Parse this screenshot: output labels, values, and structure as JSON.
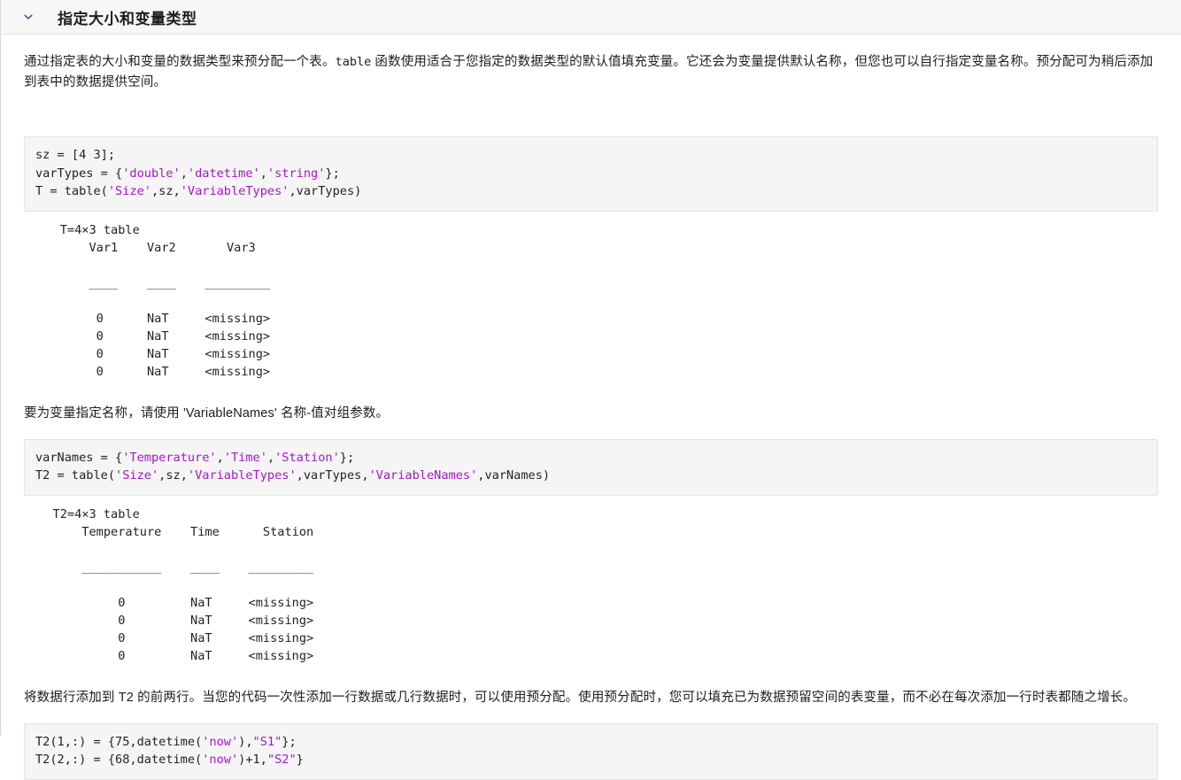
{
  "header": {
    "title": "指定大小和变量类型",
    "collapse_icon": "chevron-down-icon",
    "expanded": true
  },
  "intro_paragraph": {
    "text_before_code": "通过指定表的大小和变量的数据类型来预分配一个表。",
    "inline_code": "table",
    "text_after_code": " 函数使用适合于您指定的数据类型的默认值填充变量。它还会为变量提供默认名称，但您也可以自行指定变量名称。预分配可为稍后添加到表中的数据提供空间。"
  },
  "code_block_1": {
    "name": "preallocate-table-code",
    "lines": [
      {
        "segments": [
          {
            "t": "sz = [4 3];",
            "c": "plain"
          }
        ]
      },
      {
        "segments": [
          {
            "t": "varTypes = {",
            "c": "plain"
          },
          {
            "t": "'double'",
            "c": "str"
          },
          {
            "t": ",",
            "c": "plain"
          },
          {
            "t": "'datetime'",
            "c": "str"
          },
          {
            "t": ",",
            "c": "plain"
          },
          {
            "t": "'string'",
            "c": "str"
          },
          {
            "t": "};",
            "c": "plain"
          }
        ]
      },
      {
        "segments": [
          {
            "t": "T = table(",
            "c": "plain"
          },
          {
            "t": "'Size'",
            "c": "str"
          },
          {
            "t": ",sz,",
            "c": "plain"
          },
          {
            "t": "'VariableTypes'",
            "c": "str"
          },
          {
            "t": ",varTypes)",
            "c": "plain"
          }
        ]
      }
    ]
  },
  "output_1": {
    "name": "table-output-T",
    "caption": "T=4×3 table",
    "columns": [
      "Var1",
      "Var2",
      "Var3"
    ],
    "separators": [
      "____",
      "____",
      "_________"
    ],
    "rows": [
      [
        "0",
        "NaT",
        "<missing>"
      ],
      [
        "0",
        "NaT",
        "<missing>"
      ],
      [
        "0",
        "NaT",
        "<missing>"
      ],
      [
        "0",
        "NaT",
        "<missing>"
      ]
    ],
    "text": "    T=4×3 table\n        Var1    Var2       Var3   \n\n        ____    ____    _________\n\n         0      NaT     <missing>\n         0      NaT     <missing>\n         0      NaT     <missing>\n         0      NaT     <missing>"
  },
  "middle_paragraph": {
    "text": "要为变量指定名称，请使用 'VariableNames' 名称-值对组参数。"
  },
  "code_block_2": {
    "name": "variable-names-code",
    "lines": [
      {
        "segments": [
          {
            "t": "varNames = {",
            "c": "plain"
          },
          {
            "t": "'Temperature'",
            "c": "str"
          },
          {
            "t": ",",
            "c": "plain"
          },
          {
            "t": "'Time'",
            "c": "str"
          },
          {
            "t": ",",
            "c": "plain"
          },
          {
            "t": "'Station'",
            "c": "str"
          },
          {
            "t": "};",
            "c": "plain"
          }
        ]
      },
      {
        "segments": [
          {
            "t": "T2 = table(",
            "c": "plain"
          },
          {
            "t": "'Size'",
            "c": "str"
          },
          {
            "t": ",sz,",
            "c": "plain"
          },
          {
            "t": "'VariableTypes'",
            "c": "str"
          },
          {
            "t": ",varTypes,",
            "c": "plain"
          },
          {
            "t": "'VariableNames'",
            "c": "str"
          },
          {
            "t": ",varNames)",
            "c": "plain"
          }
        ]
      }
    ]
  },
  "output_2": {
    "name": "table-output-T2",
    "caption": "T2=4×3 table",
    "columns": [
      "Temperature",
      "Time",
      "Station"
    ],
    "separators": [
      "___________",
      "____",
      "_________"
    ],
    "rows": [
      [
        "0",
        "NaT",
        "<missing>"
      ],
      [
        "0",
        "NaT",
        "<missing>"
      ],
      [
        "0",
        "NaT",
        "<missing>"
      ],
      [
        "0",
        "NaT",
        "<missing>"
      ]
    ],
    "text": "   T2=4×3 table\n       Temperature    Time      Station \n\n       ___________    ____    _________\n\n            0         NaT     <missing>\n            0         NaT     <missing>\n            0         NaT     <missing>\n            0         NaT     <missing>"
  },
  "final_paragraph": {
    "text": "将数据行添加到 T2 的前两行。当您的代码一次性添加一行数据或几行数据时，可以使用预分配。使用预分配时，您可以填充已为数据预留空间的表变量，而不必在每次添加一行时表都随之增长。"
  },
  "code_block_3": {
    "name": "assign-rows-code",
    "lines": [
      {
        "segments": [
          {
            "t": "T2(1,:) = {75,datetime(",
            "c": "plain"
          },
          {
            "t": "'now'",
            "c": "str"
          },
          {
            "t": "),",
            "c": "plain"
          },
          {
            "t": "\"S1\"",
            "c": "dstr"
          },
          {
            "t": "};",
            "c": "plain"
          }
        ]
      },
      {
        "segments": [
          {
            "t": "T2(2,:) = {68,datetime(",
            "c": "plain"
          },
          {
            "t": "'now'",
            "c": "str"
          },
          {
            "t": ")+1,",
            "c": "plain"
          },
          {
            "t": "\"S2\"",
            "c": "dstr"
          },
          {
            "t": "}",
            "c": "plain"
          }
        ]
      }
    ]
  },
  "colors": {
    "header_bg": "#f7f7f7",
    "code_bg": "#f5f5f5",
    "code_border": "#e4e4e4",
    "string_literal": "#a517c4",
    "text": "#1c1d1f",
    "divider": "#e2e2e2"
  }
}
